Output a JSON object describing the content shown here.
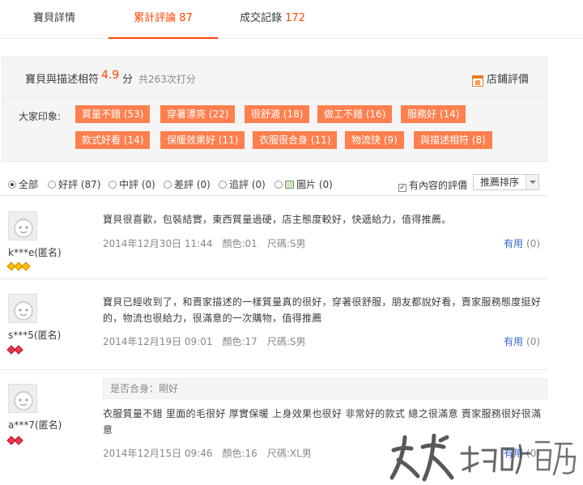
{
  "tabs": [
    {
      "label": "寶貝詳情",
      "count": ""
    },
    {
      "label": "累計評論",
      "count": "87"
    },
    {
      "label": "成交記錄",
      "count": "172"
    }
  ],
  "summary": {
    "match_label": "寶貝與描述相符",
    "score": "4.9",
    "score_unit": "分",
    "rating_count": "共263次打分",
    "shop_rating_label": "店鋪評價",
    "impression_label": "大家印象:",
    "tags": [
      "質量不錯 (53)",
      "穿著漂亮 (22)",
      "很舒適 (18)",
      "做工不錯 (16)",
      "服務好 (14)",
      "款式好看 (14)",
      "保暖效果好 (11)",
      "衣服很合身 (11)",
      "物流快 (9)",
      "與描述相符 (8)"
    ]
  },
  "filters": {
    "options": [
      {
        "label": "全部",
        "selected": true,
        "icon": ""
      },
      {
        "label": "好評 (87)",
        "selected": false,
        "icon": ""
      },
      {
        "label": "中評 (0)",
        "selected": false,
        "icon": ""
      },
      {
        "label": "差評 (0)",
        "selected": false,
        "icon": ""
      },
      {
        "label": "追評 (0)",
        "selected": false,
        "icon": ""
      },
      {
        "label": "圖片 (0)",
        "selected": false,
        "icon": "picture-icon"
      }
    ],
    "has_content_label": "有內容的評價",
    "has_content_checked": true,
    "sort_value": "推薦排序"
  },
  "reviews": [
    {
      "user": "k***e(匿名)",
      "rank_color": "#f7c000",
      "rank_count": 3,
      "fit_note": "",
      "content": "寶貝很喜歡，包裝結實，東西質量過硬，店主態度較好，快遞給力，值得推薦。",
      "date": "2014年12月30日 11:44",
      "color": "顏色:01",
      "size": "尺碼:S男",
      "useful_label": "有用",
      "useful_count": "(0)"
    },
    {
      "user": "s***5(匿名)",
      "rank_color": "#e8394b",
      "rank_count": 2,
      "fit_note": "",
      "content": "寶貝已經收到了，和賣家描述的一樣質量真的很好，穿著很舒服，朋友都說好看，賣家服務態度挺好的，物流也很給力，很滿意的一次購物，值得推薦",
      "date": "2014年12月19日 09:01",
      "color": "顏色:17",
      "size": "尺碼:S男",
      "useful_label": "有用",
      "useful_count": "(0)"
    },
    {
      "user": "a***7(匿名)",
      "rank_color": "#e8394b",
      "rank_count": 2,
      "fit_note": "是否合身：剛好",
      "content": "衣服質量不錯 里面的毛很好 厚實保暖 上身效果也很好 非常好的款式 總之很滿意 賣家服務很好很滿意",
      "date": "2014年12月15日 09:46",
      "color": "顏色:16",
      "size": "尺碼:XL男",
      "useful_label": "有用",
      "useful_count": "(0)"
    }
  ]
}
